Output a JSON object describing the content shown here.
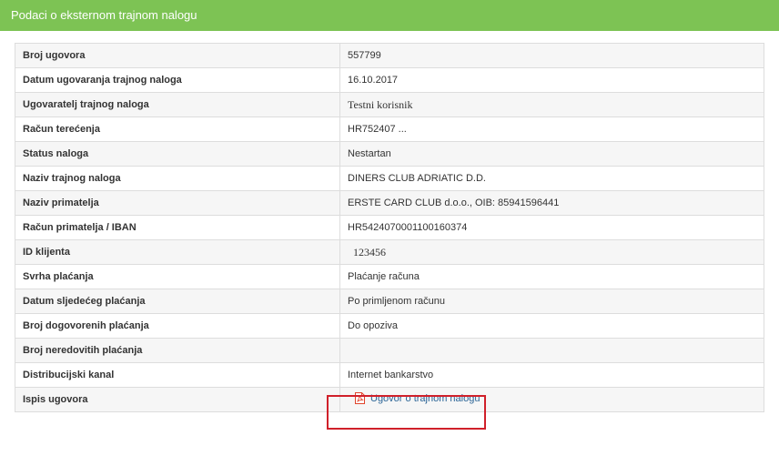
{
  "header": {
    "title": "Podaci o eksternom trajnom nalogu"
  },
  "rows": [
    {
      "label": "Broj ugovora",
      "value": "557799"
    },
    {
      "label": "Datum ugovaranja trajnog naloga",
      "value": "16.10.2017"
    },
    {
      "label": "Ugovaratelj trajnog naloga",
      "value": "Testni korisnik"
    },
    {
      "label": "Račun terećenja",
      "value": "HR752407 ..."
    },
    {
      "label": "Status naloga",
      "value": "Nestartan"
    },
    {
      "label": "Naziv trajnog naloga",
      "value": "DINERS CLUB ADRIATIC D.D."
    },
    {
      "label": "Naziv primatelja",
      "value": "ERSTE CARD CLUB d.o.o., OIB: 85941596441"
    },
    {
      "label": "Račun primatelja / IBAN",
      "value": "HR5424070001100160374"
    },
    {
      "label": "ID klijenta",
      "value": "123456"
    },
    {
      "label": "Svrha plaćanja",
      "value": "Plaćanje računa"
    },
    {
      "label": "Datum sljedećeg plaćanja",
      "value": "Po primljenom računu"
    },
    {
      "label": "Broj dogovorenih plaćanja",
      "value": "Do opoziva"
    },
    {
      "label": "Broj neredovitih plaćanja",
      "value": ""
    },
    {
      "label": "Distribucijski kanal",
      "value": "Internet bankarstvo"
    },
    {
      "label": "Ispis ugovora",
      "link_label": "Ugovor o trajnom nalogu",
      "icon": "pdf-icon"
    }
  ],
  "colors": {
    "header": "#7dc354",
    "highlight": "#d0202a",
    "link": "#2a6496"
  }
}
